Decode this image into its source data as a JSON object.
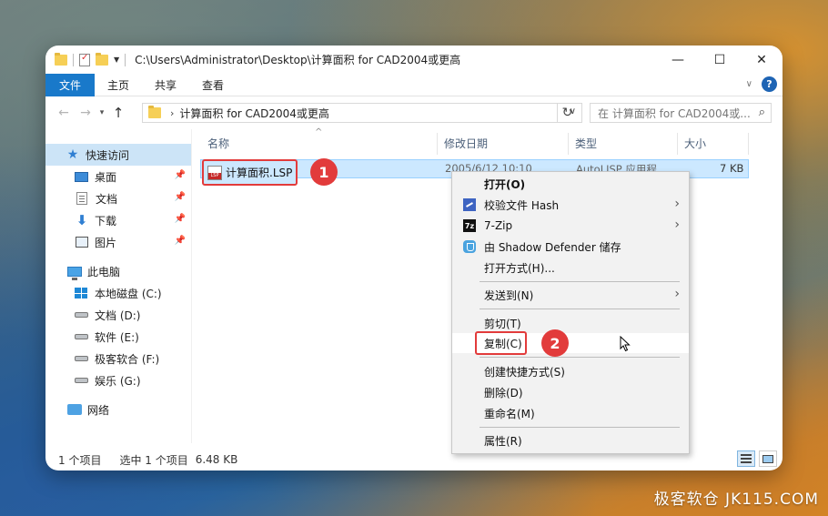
{
  "titlebar": {
    "path": "C:\\Users\\Administrator\\Desktop\\计算面积 for CAD2004或更高",
    "minimize": "—",
    "maximize": "☐",
    "close": "✕"
  },
  "ribbon": {
    "tabs": [
      {
        "label": "文件"
      },
      {
        "label": "主页"
      },
      {
        "label": "共享"
      },
      {
        "label": "查看"
      }
    ],
    "help": "?",
    "chevron": "∨"
  },
  "navbar": {
    "back": "←",
    "forward": "→",
    "recent": "▾",
    "up": "↑",
    "separator": "›",
    "address": "计算面积 for CAD2004或更高",
    "address_drop": "∨",
    "refresh": "↻",
    "search_placeholder": "在 计算面积 for CAD2004或...",
    "search_icon": "⌕"
  },
  "sidebar": {
    "quick_access": "快速访问",
    "items": [
      {
        "label": "桌面",
        "icon": "desktop-icon",
        "pinned": true
      },
      {
        "label": "文档",
        "icon": "document-icon",
        "pinned": true
      },
      {
        "label": "下载",
        "icon": "download-icon",
        "pinned": true
      },
      {
        "label": "图片",
        "icon": "pictures-icon",
        "pinned": true
      }
    ],
    "this_pc": "此电脑",
    "drives": [
      {
        "label": "本地磁盘 (C:)",
        "icon": "windows-drive-icon"
      },
      {
        "label": "文档 (D:)",
        "icon": "drive-icon"
      },
      {
        "label": "软件 (E:)",
        "icon": "drive-icon"
      },
      {
        "label": "极客软合 (F:)",
        "icon": "drive-icon"
      },
      {
        "label": "娱乐 (G:)",
        "icon": "drive-icon"
      }
    ],
    "network": "网络",
    "pin_glyph": "📌"
  },
  "filelist": {
    "columns": [
      "名称",
      "修改日期",
      "类型",
      "大小"
    ],
    "sort_arrow": "^",
    "rows": [
      {
        "name": "计算面积.LSP",
        "modified": "2005/6/12 10:10",
        "type": "AutoLISP 应用程",
        "size": "7 KB",
        "icon_text": "LSP"
      }
    ]
  },
  "badges": {
    "one": "1",
    "two": "2"
  },
  "context_menu": {
    "items": [
      {
        "label": "打开(O)"
      },
      {
        "label": "校验文件 Hash"
      },
      {
        "label": "7-Zip"
      },
      {
        "label": "由 Shadow Defender 储存"
      },
      {
        "label": "打开方式(H)..."
      },
      {
        "label": "发送到(N)"
      },
      {
        "label": "剪切(T)"
      },
      {
        "label": "复制(C)"
      },
      {
        "label": "创建快捷方式(S)"
      },
      {
        "label": "删除(D)"
      },
      {
        "label": "重命名(M)"
      },
      {
        "label": "属性(R)"
      }
    ],
    "zip_icon_text": "7z",
    "submenu_arrow": "›"
  },
  "statusbar": {
    "count": "1 个项目",
    "selected": "选中 1 个项目",
    "size": "6.48 KB"
  },
  "watermark": "极客软仓 JK115.COM",
  "colors": {
    "accent": "#1979ca",
    "selection": "#cce8ff",
    "highlight_red": "#e23b3b"
  }
}
